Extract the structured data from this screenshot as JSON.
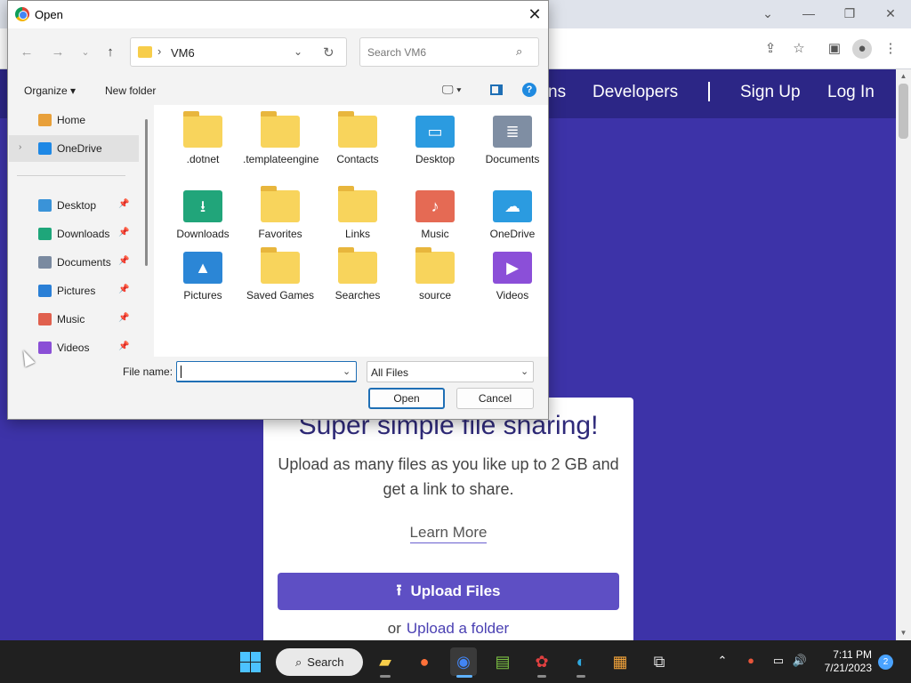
{
  "site": {
    "nav": [
      "ns",
      "Developers",
      "Sign Up",
      "Log In"
    ],
    "card_title": "Super simple file sharing!",
    "card_sub": "Upload as many files as you like up to 2 GB and get a link to share.",
    "learn_more": "Learn More",
    "upload_button": "Upload Files",
    "or_text": "or",
    "upload_folder": "Upload a folder"
  },
  "dialog": {
    "title": "Open",
    "path": "VM6",
    "search_placeholder": "Search VM6",
    "organize": "Organize",
    "new_folder": "New folder",
    "nav_items": [
      {
        "label": "Home",
        "icon": "home-icon",
        "color": "#e8a03a"
      },
      {
        "label": "OneDrive",
        "icon": "onedrive-icon",
        "color": "#1e88e5"
      },
      {
        "label": "Desktop",
        "icon": "desktop-icon",
        "color": "#3a93d8"
      },
      {
        "label": "Downloads",
        "icon": "downloads-icon",
        "color": "#1ea67a"
      },
      {
        "label": "Documents",
        "icon": "documents-icon",
        "color": "#7a8aa0"
      },
      {
        "label": "Pictures",
        "icon": "pictures-icon",
        "color": "#2a7fd6"
      },
      {
        "label": "Music",
        "icon": "music-icon",
        "color": "#e0604e"
      },
      {
        "label": "Videos",
        "icon": "videos-icon",
        "color": "#8a4fd6"
      }
    ],
    "files": [
      {
        "name": ".dotnet",
        "kind": "folder"
      },
      {
        "name": ".templateengine",
        "kind": "folder"
      },
      {
        "name": "Contacts",
        "kind": "folder"
      },
      {
        "name": "Desktop",
        "kind": "desktop"
      },
      {
        "name": "Documents",
        "kind": "documents"
      },
      {
        "name": "Downloads",
        "kind": "downloads"
      },
      {
        "name": "Favorites",
        "kind": "folder"
      },
      {
        "name": "Links",
        "kind": "folder"
      },
      {
        "name": "Music",
        "kind": "music"
      },
      {
        "name": "OneDrive",
        "kind": "onedrive"
      },
      {
        "name": "Pictures",
        "kind": "pictures"
      },
      {
        "name": "Saved Games",
        "kind": "folder"
      },
      {
        "name": "Searches",
        "kind": "folder"
      },
      {
        "name": "source",
        "kind": "folder"
      },
      {
        "name": "Videos",
        "kind": "videos"
      }
    ],
    "file_name_label": "File name:",
    "file_name_value": "",
    "file_type": "All Files",
    "open_button": "Open",
    "cancel_button": "Cancel"
  },
  "taskbar": {
    "search_label": "Search",
    "time": "7:11 PM",
    "date": "7/21/2023",
    "notification_count": "2"
  },
  "colors": {
    "site_bg": "#3d33a8",
    "nav_bg": "#2c2686",
    "accent": "#5e4fc4",
    "dialog_accent": "#1f6fb5"
  }
}
